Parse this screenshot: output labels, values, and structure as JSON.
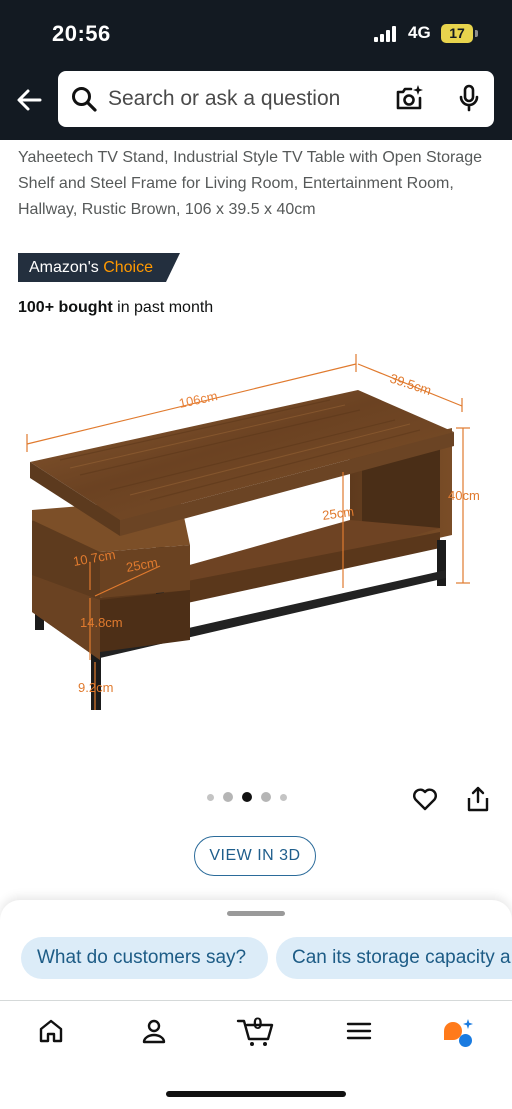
{
  "status_bar": {
    "time": "20:56",
    "network": "4G",
    "battery": "17"
  },
  "search": {
    "placeholder": "Search or ask a question"
  },
  "product": {
    "title": "Yaheetech TV Stand, Industrial Style TV Table with Open Storage Shelf and Steel Frame for Living Room, Entertainment Room, Hallway, Rustic Brown, 106 x 39.5 x 40cm",
    "badge_prefix": "Amazon's",
    "badge_highlight": "Choice",
    "bought_bold": "100+ bought",
    "bought_rest": " in past month",
    "dimensions": {
      "width": "106cm",
      "depth": "39.5cm",
      "height": "40cm",
      "inner_height": "25cm",
      "shelf_height": "10.7cm",
      "shelf_width": "25cm",
      "side_height": "14.8cm",
      "leg_height": "9.2cm"
    }
  },
  "gallery": {
    "dot_count": 5,
    "active_index": 2
  },
  "view3d_label": "VIEW IN 3D",
  "suggestions": [
    "What do customers say?",
    "Can its storage capacity a"
  ],
  "tabs": {
    "cart_count": "0"
  },
  "colors": {
    "header_bg": "#131a22",
    "badge_bg": "#232f3e",
    "badge_accent": "#ff9900",
    "link_blue": "#1d5c86",
    "pill_bg": "#dcecf8"
  }
}
